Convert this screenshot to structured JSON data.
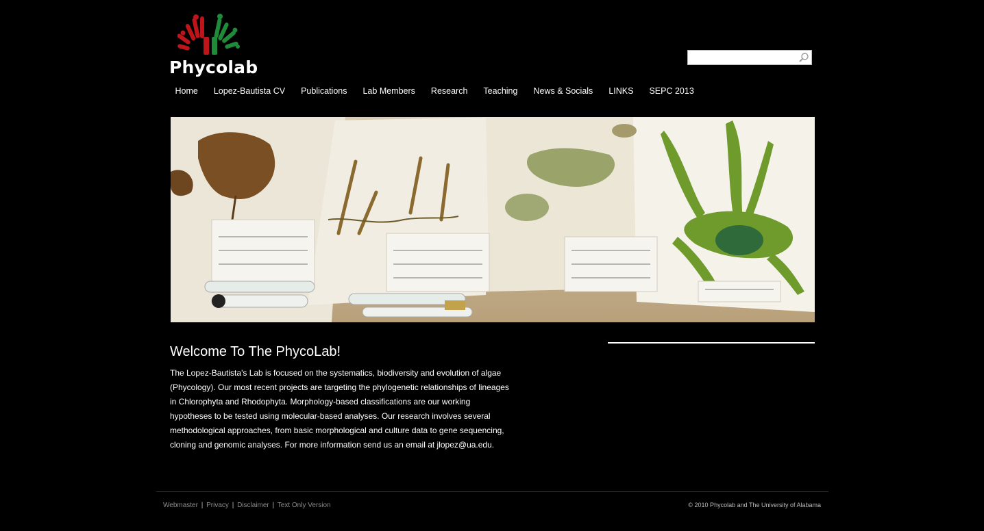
{
  "site": {
    "logo_text": "Phycolab"
  },
  "search": {
    "placeholder": "",
    "value": ""
  },
  "nav": {
    "items": [
      {
        "label": "Home"
      },
      {
        "label": "Lopez-Bautista CV"
      },
      {
        "label": "Publications"
      },
      {
        "label": "Lab Members"
      },
      {
        "label": "Research"
      },
      {
        "label": "Teaching"
      },
      {
        "label": "News & Socials"
      },
      {
        "label": "LINKS"
      },
      {
        "label": "SEPC 2013"
      }
    ]
  },
  "main": {
    "title": "Welcome To The PhycoLab!",
    "intro": "The Lopez-Bautista's Lab is focused on the systematics, biodiversity and evolution of algae (Phycology). Our most recent projects are targeting the phylogenetic relationships of lineages in Chlorophyta and Rhodophyta. Morphology-based classifications are our working hypotheses to be tested using molecular-based analyses. Our research involves several methodological approaches, from basic morphological and culture data to gene sequencing, cloning and genomic analyses. For more information send us an email at jlopez@ua.edu."
  },
  "footer": {
    "links": [
      {
        "label": "Webmaster"
      },
      {
        "label": "Privacy"
      },
      {
        "label": "Disclaimer"
      },
      {
        "label": "Text Only Version"
      }
    ],
    "separator": "|",
    "copyright": "© 2010 Phycolab and The University of Alabama"
  },
  "colors": {
    "background": "#000000",
    "logo_red": "#c0141b",
    "logo_green": "#1f8a3a",
    "footer_text": "#8c8c8c"
  },
  "icons": {
    "search": "magnifier-icon"
  }
}
